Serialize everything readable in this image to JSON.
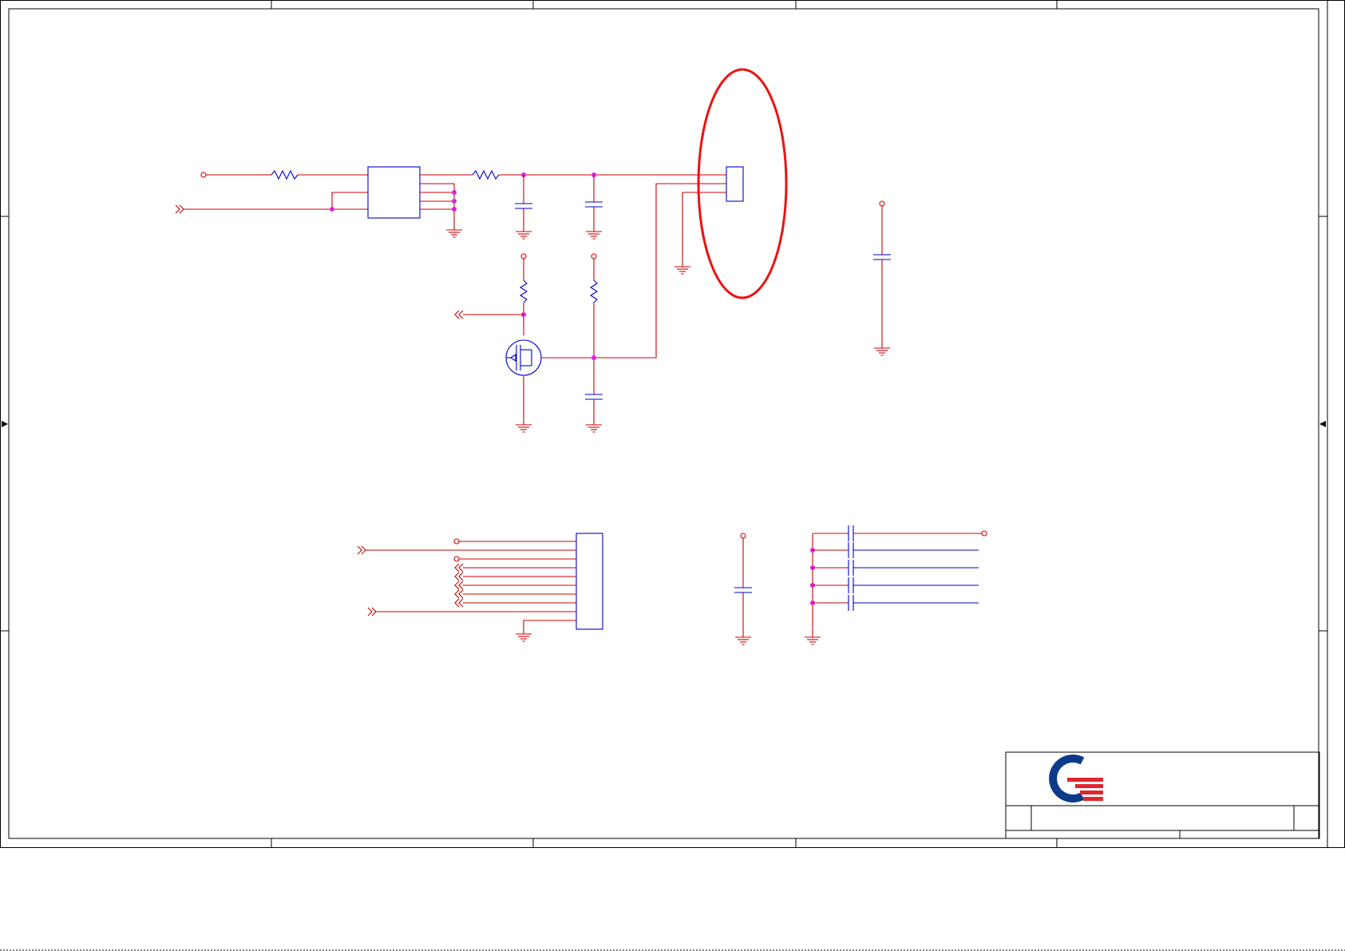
{
  "sheet": {
    "kind": "schematic",
    "colors": {
      "wire": "#cc0000",
      "component": "#0000cc",
      "junction": "#e020e0",
      "highlight": "#ee1111",
      "frame": "#000000",
      "logo_blue": "#0d3b8c",
      "logo_red": "#e0262e"
    },
    "icons": [
      "ground-symbol-icon",
      "offpage-arrow-icon",
      "power-pin-icon",
      "resistor-icon",
      "capacitor-icon",
      "mosfet-icon",
      "connector-icon",
      "logo-q-icon"
    ],
    "title_block": {
      "logo": "logo-q-icon",
      "title": "",
      "sheet_number": ""
    }
  }
}
